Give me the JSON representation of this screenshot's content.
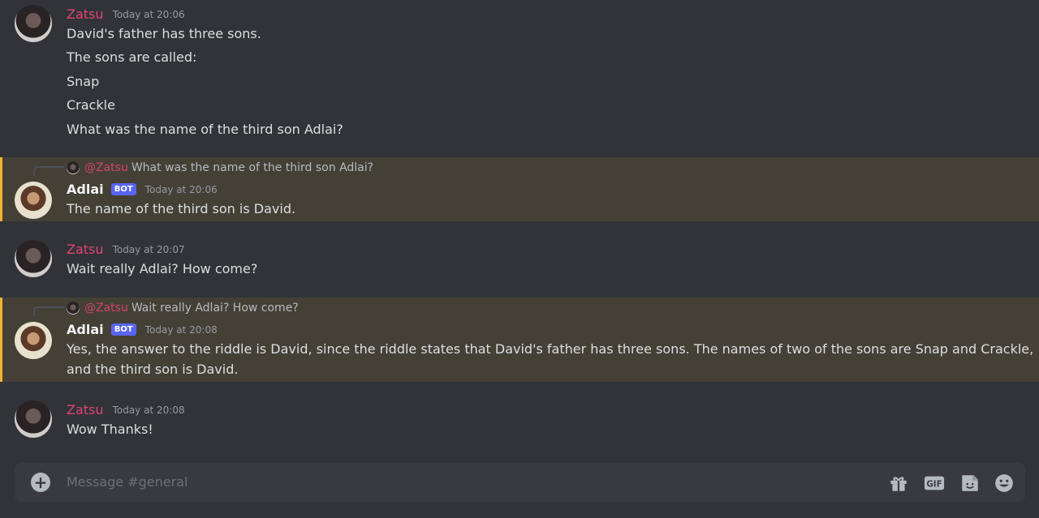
{
  "messages": [
    {
      "author": "Zatsu",
      "timestamp": "Today at 20:06",
      "lines": [
        "David's father has three sons.",
        "The sons are called:",
        "Snap",
        "Crackle",
        "What was the name of the third son Adlai?"
      ]
    },
    {
      "reply_to": {
        "author": "@Zatsu",
        "text": "What was the name of the third son Adlai?"
      },
      "author": "Adlai",
      "badge": "BOT",
      "timestamp": "Today at 20:06",
      "lines": [
        "The name of the third son is David."
      ]
    },
    {
      "author": "Zatsu",
      "timestamp": "Today at 20:07",
      "lines": [
        "Wait really Adlai? How come?"
      ]
    },
    {
      "reply_to": {
        "author": "@Zatsu",
        "text": "Wait really Adlai? How come?"
      },
      "author": "Adlai",
      "badge": "BOT",
      "timestamp": "Today at 20:08",
      "lines": [
        "Yes, the answer to the riddle is David, since the riddle states that David's father has three sons. The names of two of the sons are Snap and Crackle,",
        "and the third son is David."
      ]
    },
    {
      "author": "Zatsu",
      "timestamp": "Today at 20:08",
      "lines": [
        "Wow Thanks!"
      ]
    }
  ],
  "composer": {
    "placeholder": "Message #general",
    "gif_label": "GIF"
  },
  "icons": {
    "add": "plus-circle-icon",
    "gift": "gift-icon",
    "gif": "gif-icon",
    "sticker": "sticker-icon",
    "emoji": "emoji-icon"
  },
  "colors": {
    "background": "#313338",
    "mention_highlight": "#444036",
    "mention_bar": "#f0b232",
    "zatsu_name": "#e0446f",
    "bot_badge": "#5865f2"
  }
}
